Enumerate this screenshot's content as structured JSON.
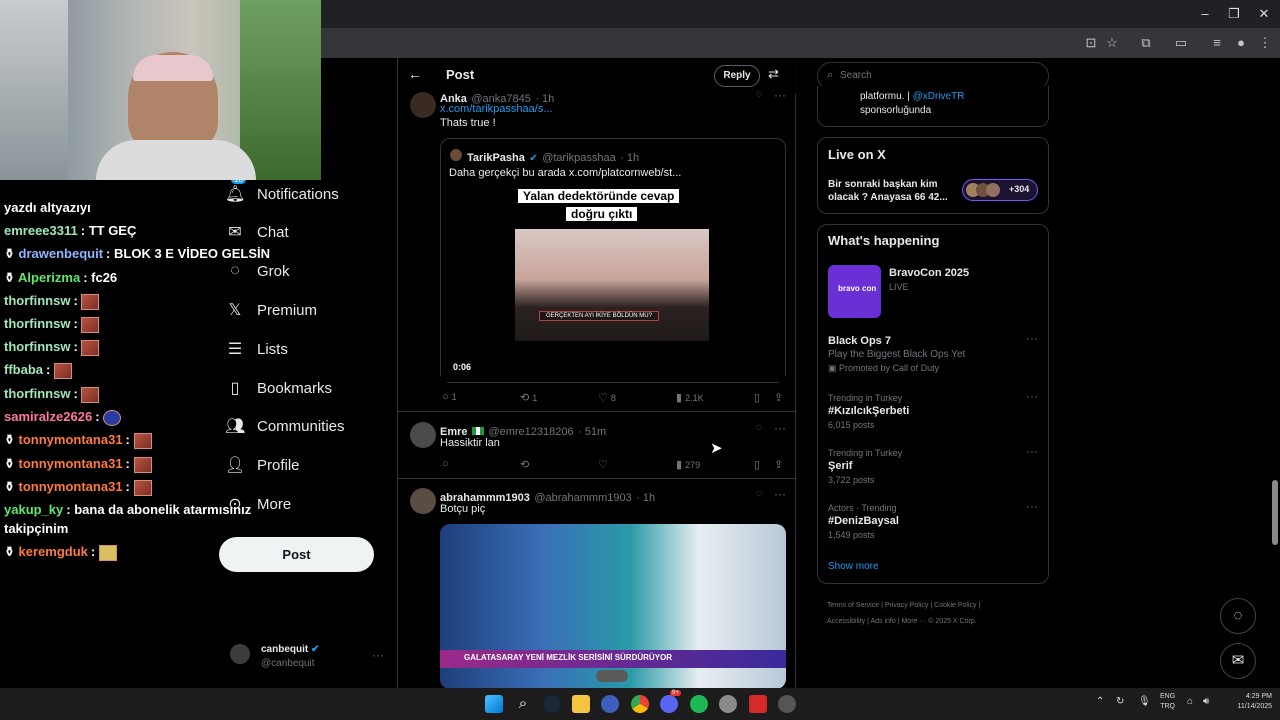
{
  "window": {
    "minimize": "–",
    "maximize": "❐",
    "close": "✕"
  },
  "chat": [
    {
      "user": "yazdı altyazıyı",
      "msg": "",
      "color": "#ffffff"
    },
    {
      "user": "emreee3311",
      "msg": "TT GEÇ",
      "color": "#9fe7b9"
    },
    {
      "user": "drawenbequit",
      "msg": "BLOK 3 E VİDEO GELSİN",
      "color": "#8fb5ff"
    },
    {
      "user": "Alperizma",
      "msg": "fc26",
      "color": "#61e86a"
    },
    {
      "user": "thorfinnsw",
      "msg": "",
      "color": "#9fe7b9"
    },
    {
      "user": "thorfinnsw",
      "msg": "",
      "color": "#9fe7b9"
    },
    {
      "user": "thorfinnsw",
      "msg": "",
      "color": "#9fe7b9"
    },
    {
      "user": "ffbaba",
      "msg": "",
      "color": "#9fe7b9"
    },
    {
      "user": "thorfinnsw",
      "msg": "",
      "color": "#9fe7b9"
    },
    {
      "user": "samiralze2626",
      "msg": "",
      "color": "#ff7a9a"
    },
    {
      "user": "tonnymontana31",
      "msg": "",
      "color": "#ff7a3d"
    },
    {
      "user": "tonnymontana31",
      "msg": "",
      "color": "#ff7a3d"
    },
    {
      "user": "tonnymontana31",
      "msg": "",
      "color": "#ff7a3d"
    },
    {
      "user": "yakup_ky",
      "msg": "bana da abonelik atarmısınız",
      "color": "#61e86a"
    },
    {
      "user": "takipçinim",
      "msg": "",
      "color": "#ffffff"
    },
    {
      "user": "keremgduk",
      "msg": "",
      "color": "#ff7a3d"
    }
  ],
  "nav": {
    "notifications": "Notifications",
    "notifications_badge": "18",
    "chat": "Chat",
    "grok": "Grok",
    "premium": "Premium",
    "lists": "Lists",
    "bookmarks": "Bookmarks",
    "communities": "Communities",
    "profile": "Profile",
    "more": "More",
    "post_button": "Post"
  },
  "account": {
    "name": "canbequit",
    "handle": "@canbequit"
  },
  "timeline": {
    "header_title": "Post",
    "reply_button": "Reply",
    "tweets": [
      {
        "name": "Anka",
        "handle": "@anka7845",
        "time": "· 1h",
        "link": "x.com/tarikpasshaa/s...",
        "text": "Thats true !",
        "quote": {
          "name": "TarikPasha",
          "handle": "@tarikpasshaa",
          "time": "· 1h",
          "text": "Daha gerçekçi bu arada  x.com/platcornweb/st...",
          "caption_line1": "Yalan dedektöründe cevap",
          "caption_line2": "doğru çıktı",
          "subtitle": "GERÇEKTEN AYI İKİYE BÖLDÜN MU?",
          "duration": "0:06"
        },
        "replies": "1",
        "reposts": "1",
        "likes": "8",
        "views": "2.1K"
      },
      {
        "name": "Emre",
        "handle": "@emre12318206",
        "time": "· 51m",
        "text": "Hassiktir lan",
        "replies": "",
        "reposts": "",
        "likes": "",
        "views": "279"
      },
      {
        "name": "abrahammm1903",
        "handle": "@abrahammm1903",
        "time": "· 1h",
        "text": "Botçu piç",
        "banner": "GALATASARAY YENİ MEZLİK SERİSİNİ SÜRDÜRÜYOR"
      }
    ]
  },
  "sidebar": {
    "search_placeholder": "Search",
    "sponsor_line1": "platformu. | ",
    "sponsor_link": "@xDriveTR",
    "sponsor_line2": "sponsorluğunda",
    "live_title": "Live on X",
    "live_text": "Bir sonraki başkan kim olacak ? Anayasa 66 42...",
    "live_count": "+304",
    "happening_title": "What's happening",
    "event_name": "BravoCon 2025",
    "event_status": "LIVE",
    "event_logo": "bravo con",
    "trends": [
      {
        "label": "",
        "title": "Black Ops 7",
        "sub": "Play the Biggest Black Ops Yet",
        "promo": "Promoted by Call of Duty"
      },
      {
        "label": "Trending in Turkey",
        "title": "#KızılcıkŞerbeti",
        "sub": "6,015 posts"
      },
      {
        "label": "Trending in Turkey",
        "title": "Şerif",
        "sub": "3,722 posts"
      },
      {
        "label": "Actors · Trending",
        "title": "#DenizBaysal",
        "sub": "1,549 posts"
      }
    ],
    "show_more": "Show more",
    "footer": [
      "Terms of Service",
      "Privacy Policy",
      "Cookie Policy",
      "Accessibility",
      "Ads info",
      "More ···",
      "© 2025 X Corp."
    ]
  },
  "taskbar": {
    "lang1": "ENG",
    "lang2": "TRQ",
    "time": "4:29 PM",
    "date": "11/14/2025",
    "discord_badge": "9+"
  }
}
